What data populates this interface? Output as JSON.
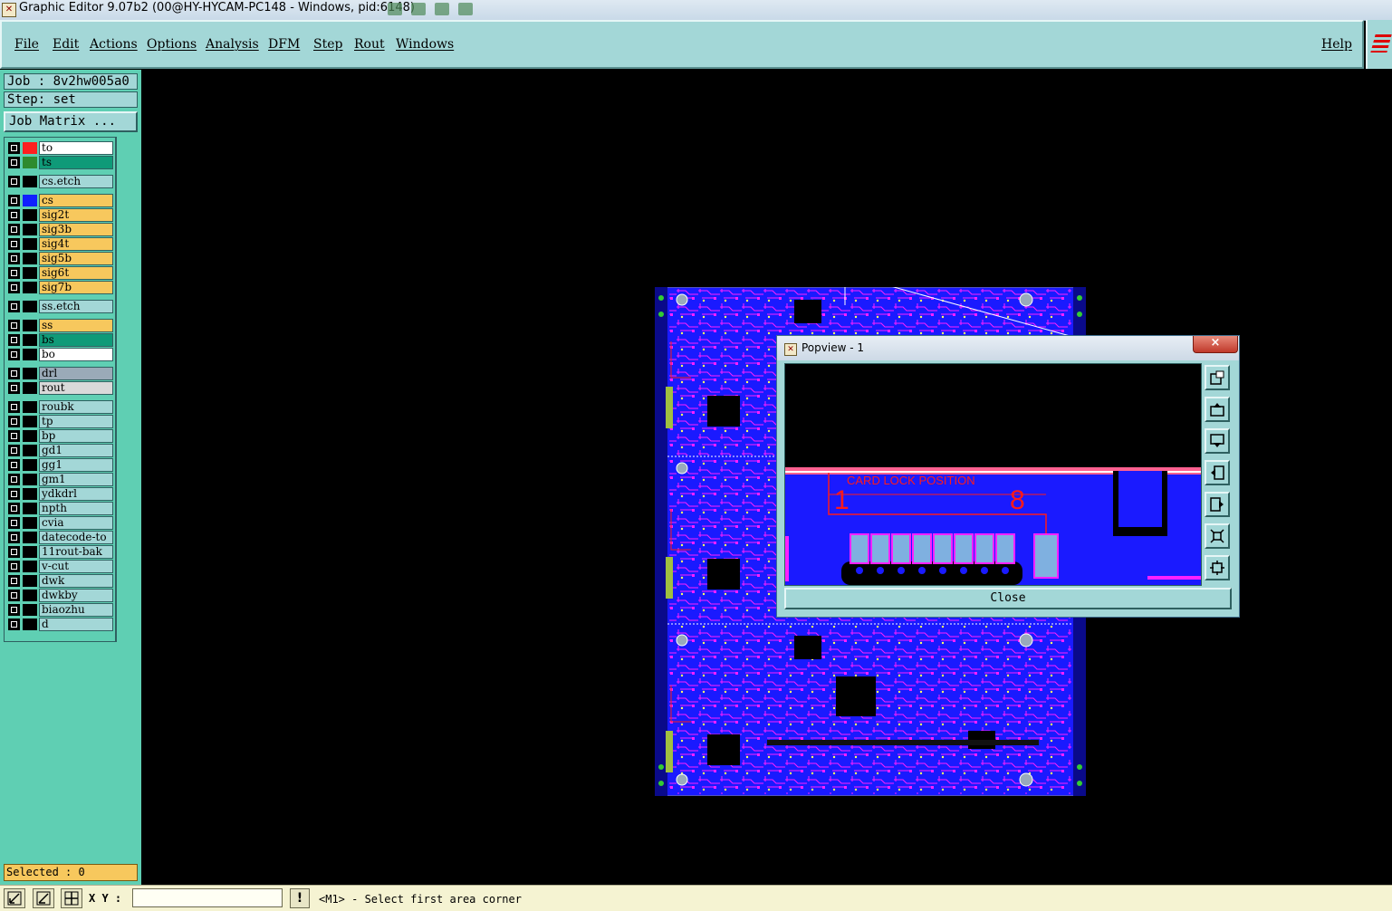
{
  "window": {
    "title": "Graphic Editor 9.07b2 (00@HY-HYCAM-PC148 - Windows, pid:6148)"
  },
  "menu": {
    "items": [
      "File",
      "Edit",
      "Actions",
      "Options",
      "Analysis",
      "DFM",
      "Step",
      "Rout",
      "Windows"
    ],
    "help": "Help"
  },
  "panel": {
    "job": "Job : 8v2hw005a0",
    "step": "Step: set",
    "job_matrix": "Job Matrix ...",
    "selected": "Selected : 0"
  },
  "layers": [
    {
      "name": "to",
      "bg": "#ffffff",
      "swatch": "#ff2020",
      "active": true
    },
    {
      "name": "ts",
      "bg": "#0f9a78",
      "swatch": "#2e8b2e"
    },
    {
      "name": "cs.etch",
      "bg": "#a3d7d7",
      "swatch": ""
    },
    {
      "name": "cs",
      "bg": "#f7c85d",
      "swatch": "#1020ff"
    },
    {
      "name": "sig2t",
      "bg": "#f7c85d",
      "swatch": ""
    },
    {
      "name": "sig3b",
      "bg": "#f7c85d",
      "swatch": ""
    },
    {
      "name": "sig4t",
      "bg": "#f7c85d",
      "swatch": ""
    },
    {
      "name": "sig5b",
      "bg": "#f7c85d",
      "swatch": ""
    },
    {
      "name": "sig6t",
      "bg": "#f7c85d",
      "swatch": ""
    },
    {
      "name": "sig7b",
      "bg": "#f7c85d",
      "swatch": ""
    },
    {
      "name": "ss.etch",
      "bg": "#a3d7d7",
      "swatch": ""
    },
    {
      "name": "ss",
      "bg": "#f7c85d",
      "swatch": ""
    },
    {
      "name": "bs",
      "bg": "#0f9a78",
      "swatch": ""
    },
    {
      "name": "bo",
      "bg": "#ffffff",
      "swatch": ""
    },
    {
      "name": "drl",
      "bg": "#9aaab8",
      "swatch": ""
    },
    {
      "name": "rout",
      "bg": "#d9d9d9",
      "swatch": ""
    },
    {
      "name": "roubk",
      "bg": "#a3d7d7",
      "swatch": ""
    },
    {
      "name": "tp",
      "bg": "#a3d7d7",
      "swatch": ""
    },
    {
      "name": "bp",
      "bg": "#a3d7d7",
      "swatch": ""
    },
    {
      "name": "gd1",
      "bg": "#a3d7d7",
      "swatch": ""
    },
    {
      "name": "gg1",
      "bg": "#a3d7d7",
      "swatch": ""
    },
    {
      "name": "gm1",
      "bg": "#a3d7d7",
      "swatch": ""
    },
    {
      "name": "ydkdrl",
      "bg": "#a3d7d7",
      "swatch": ""
    },
    {
      "name": "npth",
      "bg": "#a3d7d7",
      "swatch": ""
    },
    {
      "name": "cvia",
      "bg": "#a3d7d7",
      "swatch": ""
    },
    {
      "name": "datecode-to",
      "bg": "#a3d7d7",
      "swatch": ""
    },
    {
      "name": "11rout-bak",
      "bg": "#a3d7d7",
      "swatch": ""
    },
    {
      "name": "v-cut",
      "bg": "#a3d7d7",
      "swatch": ""
    },
    {
      "name": "dwk",
      "bg": "#a3d7d7",
      "swatch": ""
    },
    {
      "name": "dwkby",
      "bg": "#a3d7d7",
      "swatch": ""
    },
    {
      "name": "biaozhu",
      "bg": "#a3d7d7",
      "swatch": ""
    },
    {
      "name": "d",
      "bg": "#a3d7d7",
      "swatch": ""
    }
  ],
  "popview": {
    "title": "Popview - 1",
    "close_x": "×",
    "close_label": "Close",
    "silk_text": "CARD LOCK POSITION",
    "pin_left": "1",
    "pin_right": "8"
  },
  "status": {
    "xy_label": "X Y :",
    "xy_value": "",
    "warn": "!",
    "prompt": "<M1> - Select first area corner"
  },
  "colors": {
    "panel_bg": "#5fcfb3",
    "menu_bg": "#a3d7d7",
    "board_blue": "#1a1aff",
    "trace_magenta": "#ff20ff",
    "silk_red": "#ff1a1a"
  }
}
